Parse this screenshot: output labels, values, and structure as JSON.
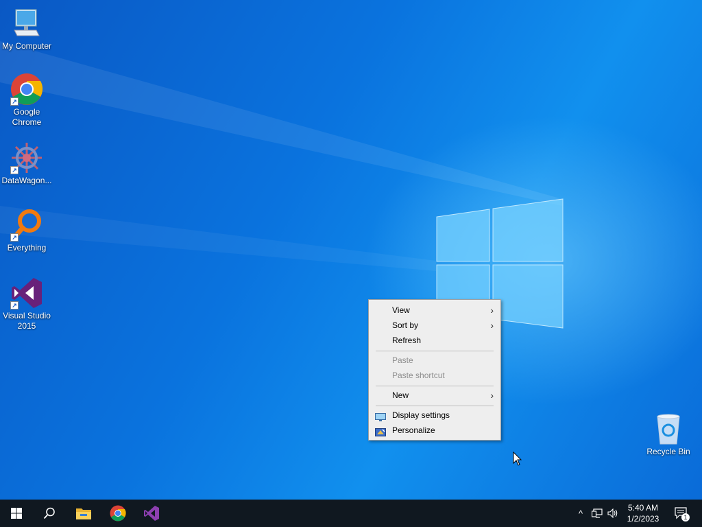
{
  "desktop": {
    "icons": [
      {
        "label": "My Computer",
        "icon": "monitor-icon"
      },
      {
        "label": "Google Chrome",
        "icon": "chrome-icon"
      },
      {
        "label": "DataWagon...",
        "icon": "datawagon-icon"
      },
      {
        "label": "Everything",
        "icon": "magnifier-icon"
      },
      {
        "label": "Visual Studio 2015",
        "icon": "visual-studio-icon"
      },
      {
        "label": "Recycle Bin",
        "icon": "recycle-bin-icon"
      }
    ]
  },
  "context_menu": {
    "items": [
      {
        "label": "View",
        "submenu": true,
        "enabled": true
      },
      {
        "label": "Sort by",
        "submenu": true,
        "enabled": true
      },
      {
        "label": "Refresh",
        "submenu": false,
        "enabled": true
      },
      {
        "label": "Paste",
        "submenu": false,
        "enabled": false
      },
      {
        "label": "Paste shortcut",
        "submenu": false,
        "enabled": false
      },
      {
        "label": "New",
        "submenu": true,
        "enabled": true
      },
      {
        "label": "Display settings",
        "submenu": false,
        "enabled": true,
        "icon": "display-icon"
      },
      {
        "label": "Personalize",
        "submenu": false,
        "enabled": true,
        "icon": "personalize-icon"
      }
    ],
    "arrow_glyph": "›"
  },
  "taskbar": {
    "pinned": [
      "start-icon",
      "search-icon",
      "file-explorer-icon",
      "chrome-icon",
      "visual-studio-icon"
    ],
    "tray": {
      "chevron": "^",
      "time": "5:40 AM",
      "date": "1/2/2023",
      "notification_count": "1"
    }
  },
  "colors": {
    "desktop_blue": "#0a6fd8",
    "taskbar": "#101820",
    "menu_bg": "#eeeeee",
    "vs_purple": "#68217a"
  }
}
